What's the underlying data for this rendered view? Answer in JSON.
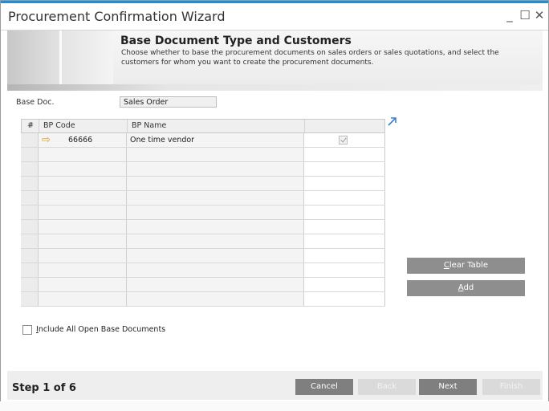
{
  "window": {
    "title": "Procurement Confirmation Wizard",
    "minimize": "_",
    "maximize": "☐",
    "close": "✕"
  },
  "header": {
    "title": "Base Document Type and Customers",
    "description": "Choose whether to base the procurement documents on sales orders or sales quotations, and select the customers for whom you want to create the procurement documents."
  },
  "base_doc": {
    "label": "Base Doc.",
    "value": "Sales Order"
  },
  "grid": {
    "columns": [
      "#",
      "BP Code",
      "BP Name",
      ""
    ],
    "rows": [
      {
        "code": "66666",
        "name": "One time vendor",
        "checked": true
      }
    ],
    "empty_row_count": 11
  },
  "side_buttons": {
    "clear_prefix": "",
    "clear_mnemonic": "C",
    "clear_rest": "lear Table",
    "add_prefix": "",
    "add_mnemonic": "A",
    "add_rest": "dd"
  },
  "include_open": {
    "mnemonic": "I",
    "rest": "nclude All Open Base Documents",
    "checked": false
  },
  "footer": {
    "step": "Step 1 of 6",
    "cancel": "Cancel",
    "back": "Back",
    "next": "Next",
    "finish": "Finish"
  },
  "colors": {
    "accent": "#1d8fd6",
    "arrow": "#e3a01e",
    "button": "#8e8e8e"
  },
  "icons": [
    "minimize-icon",
    "maximize-icon",
    "close-icon",
    "arrow-right-icon",
    "checkbox-icon",
    "expand-icon"
  ]
}
